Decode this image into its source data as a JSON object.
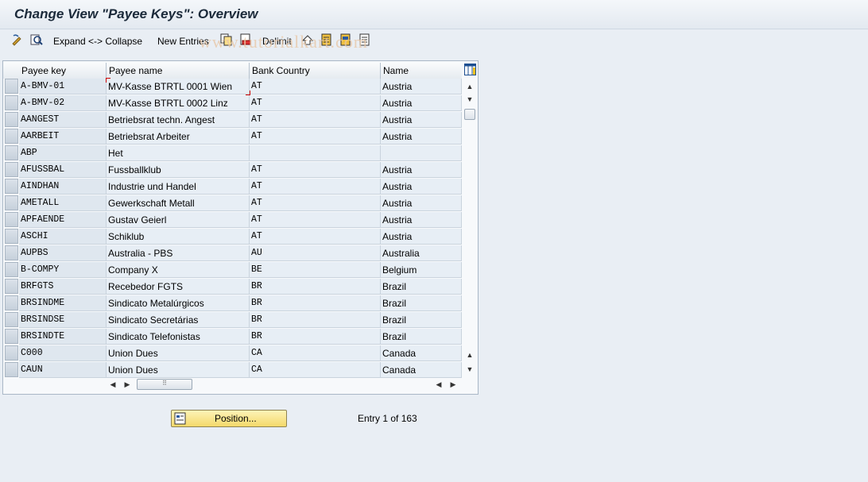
{
  "title": "Change View \"Payee Keys\": Overview",
  "toolbar": {
    "expand_collapse": "Expand <-> Collapse",
    "new_entries": "New Entries",
    "delimit": "Delimit"
  },
  "watermark": "www.tutorialkart.com",
  "table": {
    "columns": [
      "Payee key",
      "Payee name",
      "Bank Country",
      "Name"
    ],
    "rows": [
      {
        "key": "A-BMV-01",
        "name": "MV-Kasse  BTRTL 0001 Wien",
        "country": "AT",
        "cname": "Austria"
      },
      {
        "key": "A-BMV-02",
        "name": "MV-Kasse  BTRTL 0002 Linz",
        "country": "AT",
        "cname": "Austria"
      },
      {
        "key": "AANGEST",
        "name": "Betriebsrat techn. Angest",
        "country": "AT",
        "cname": "Austria"
      },
      {
        "key": "AARBEIT",
        "name": "Betriebsrat Arbeiter",
        "country": "AT",
        "cname": "Austria"
      },
      {
        "key": "ABP",
        "name": "Het",
        "country": "",
        "cname": ""
      },
      {
        "key": "AFUSSBAL",
        "name": "Fussballklub",
        "country": "AT",
        "cname": "Austria"
      },
      {
        "key": "AINDHAN",
        "name": "Industrie und Handel",
        "country": "AT",
        "cname": "Austria"
      },
      {
        "key": "AMETALL",
        "name": "Gewerkschaft Metall",
        "country": "AT",
        "cname": "Austria"
      },
      {
        "key": "APFAENDE",
        "name": "Gustav Geierl",
        "country": "AT",
        "cname": "Austria"
      },
      {
        "key": "ASCHI",
        "name": "Schiklub",
        "country": "AT",
        "cname": "Austria"
      },
      {
        "key": "AUPBS",
        "name": "Australia - PBS",
        "country": "AU",
        "cname": "Australia"
      },
      {
        "key": "B-COMPY",
        "name": "Company X",
        "country": "BE",
        "cname": "Belgium"
      },
      {
        "key": "BRFGTS",
        "name": "Recebedor FGTS",
        "country": "BR",
        "cname": "Brazil"
      },
      {
        "key": "BRSINDME",
        "name": "Sindicato Metalúrgicos",
        "country": "BR",
        "cname": "Brazil"
      },
      {
        "key": "BRSINDSE",
        "name": "Sindicato Secretárias",
        "country": "BR",
        "cname": "Brazil"
      },
      {
        "key": "BRSINDTE",
        "name": "Sindicato Telefonistas",
        "country": "BR",
        "cname": "Brazil"
      },
      {
        "key": "C000",
        "name": "Union Dues",
        "country": "CA",
        "cname": "Canada"
      },
      {
        "key": "CAUN",
        "name": "Union Dues",
        "country": "CA",
        "cname": "Canada"
      }
    ]
  },
  "position_button": "Position...",
  "entry_info": "Entry 1 of 163"
}
